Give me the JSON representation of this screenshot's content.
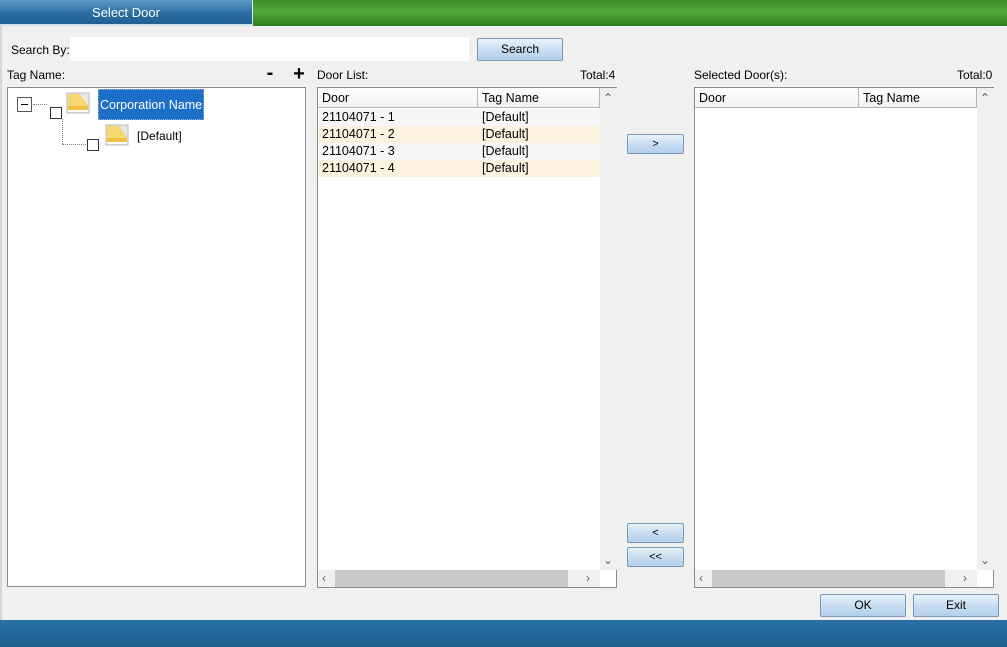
{
  "window": {
    "title": "Select Door"
  },
  "search": {
    "label": "Search By:",
    "value": "",
    "placeholder": "",
    "button_label": "Search"
  },
  "tag_tree": {
    "label": "Tag Name:",
    "collapse_symbol": "-",
    "expand_symbol": "+",
    "root": {
      "label": "Corporation Name",
      "children": [
        {
          "label": "[Default]"
        }
      ]
    }
  },
  "door_list": {
    "label": "Door List:",
    "total": "Total:4",
    "columns": [
      "Door",
      "Tag Name"
    ],
    "rows": [
      {
        "door": "21104071 - 1",
        "tag": "[Default]"
      },
      {
        "door": "21104071 - 2",
        "tag": "[Default]"
      },
      {
        "door": "21104071 - 3",
        "tag": "[Default]"
      },
      {
        "door": "21104071 - 4",
        "tag": "[Default]"
      }
    ]
  },
  "transfer": {
    "add_label": ">",
    "remove_label": "<",
    "remove_all_label": "<<"
  },
  "selected_doors": {
    "label": "Selected Door(s):",
    "total": "Total:0",
    "columns": [
      "Door",
      "Tag Name"
    ],
    "rows": []
  },
  "footer": {
    "ok_label": "OK",
    "exit_label": "Exit"
  },
  "colors": {
    "selection": "#1c6fc9",
    "alt_row": "#fdf1e0",
    "titlebar_green": "#52a83a",
    "titlebar_blue": "#2c6ea2"
  }
}
